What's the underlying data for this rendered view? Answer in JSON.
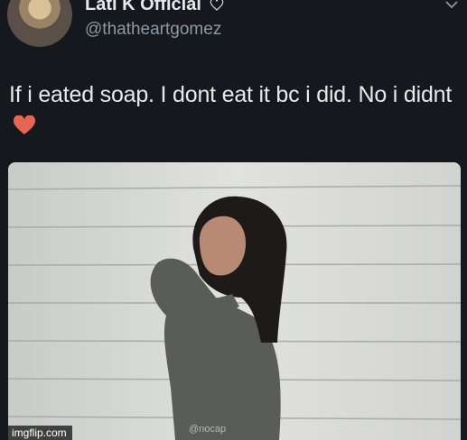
{
  "tweet": {
    "display_name": "Lati K Official",
    "handle": "@thatheartgomez",
    "text": "If i eated soap. I dont eat it bc i did. No i didnt",
    "emoji": "heart"
  },
  "photo": {
    "inner_watermark": "@nocap",
    "site_watermark": "imgflip.com"
  },
  "colors": {
    "background": "#15181c",
    "primary_text": "#e7e9ea",
    "secondary_text": "#8b98a5",
    "heart": "#e8664f"
  },
  "icons": [
    "verified-badge-icon",
    "chevron-down-icon",
    "heart-emoji-icon"
  ]
}
